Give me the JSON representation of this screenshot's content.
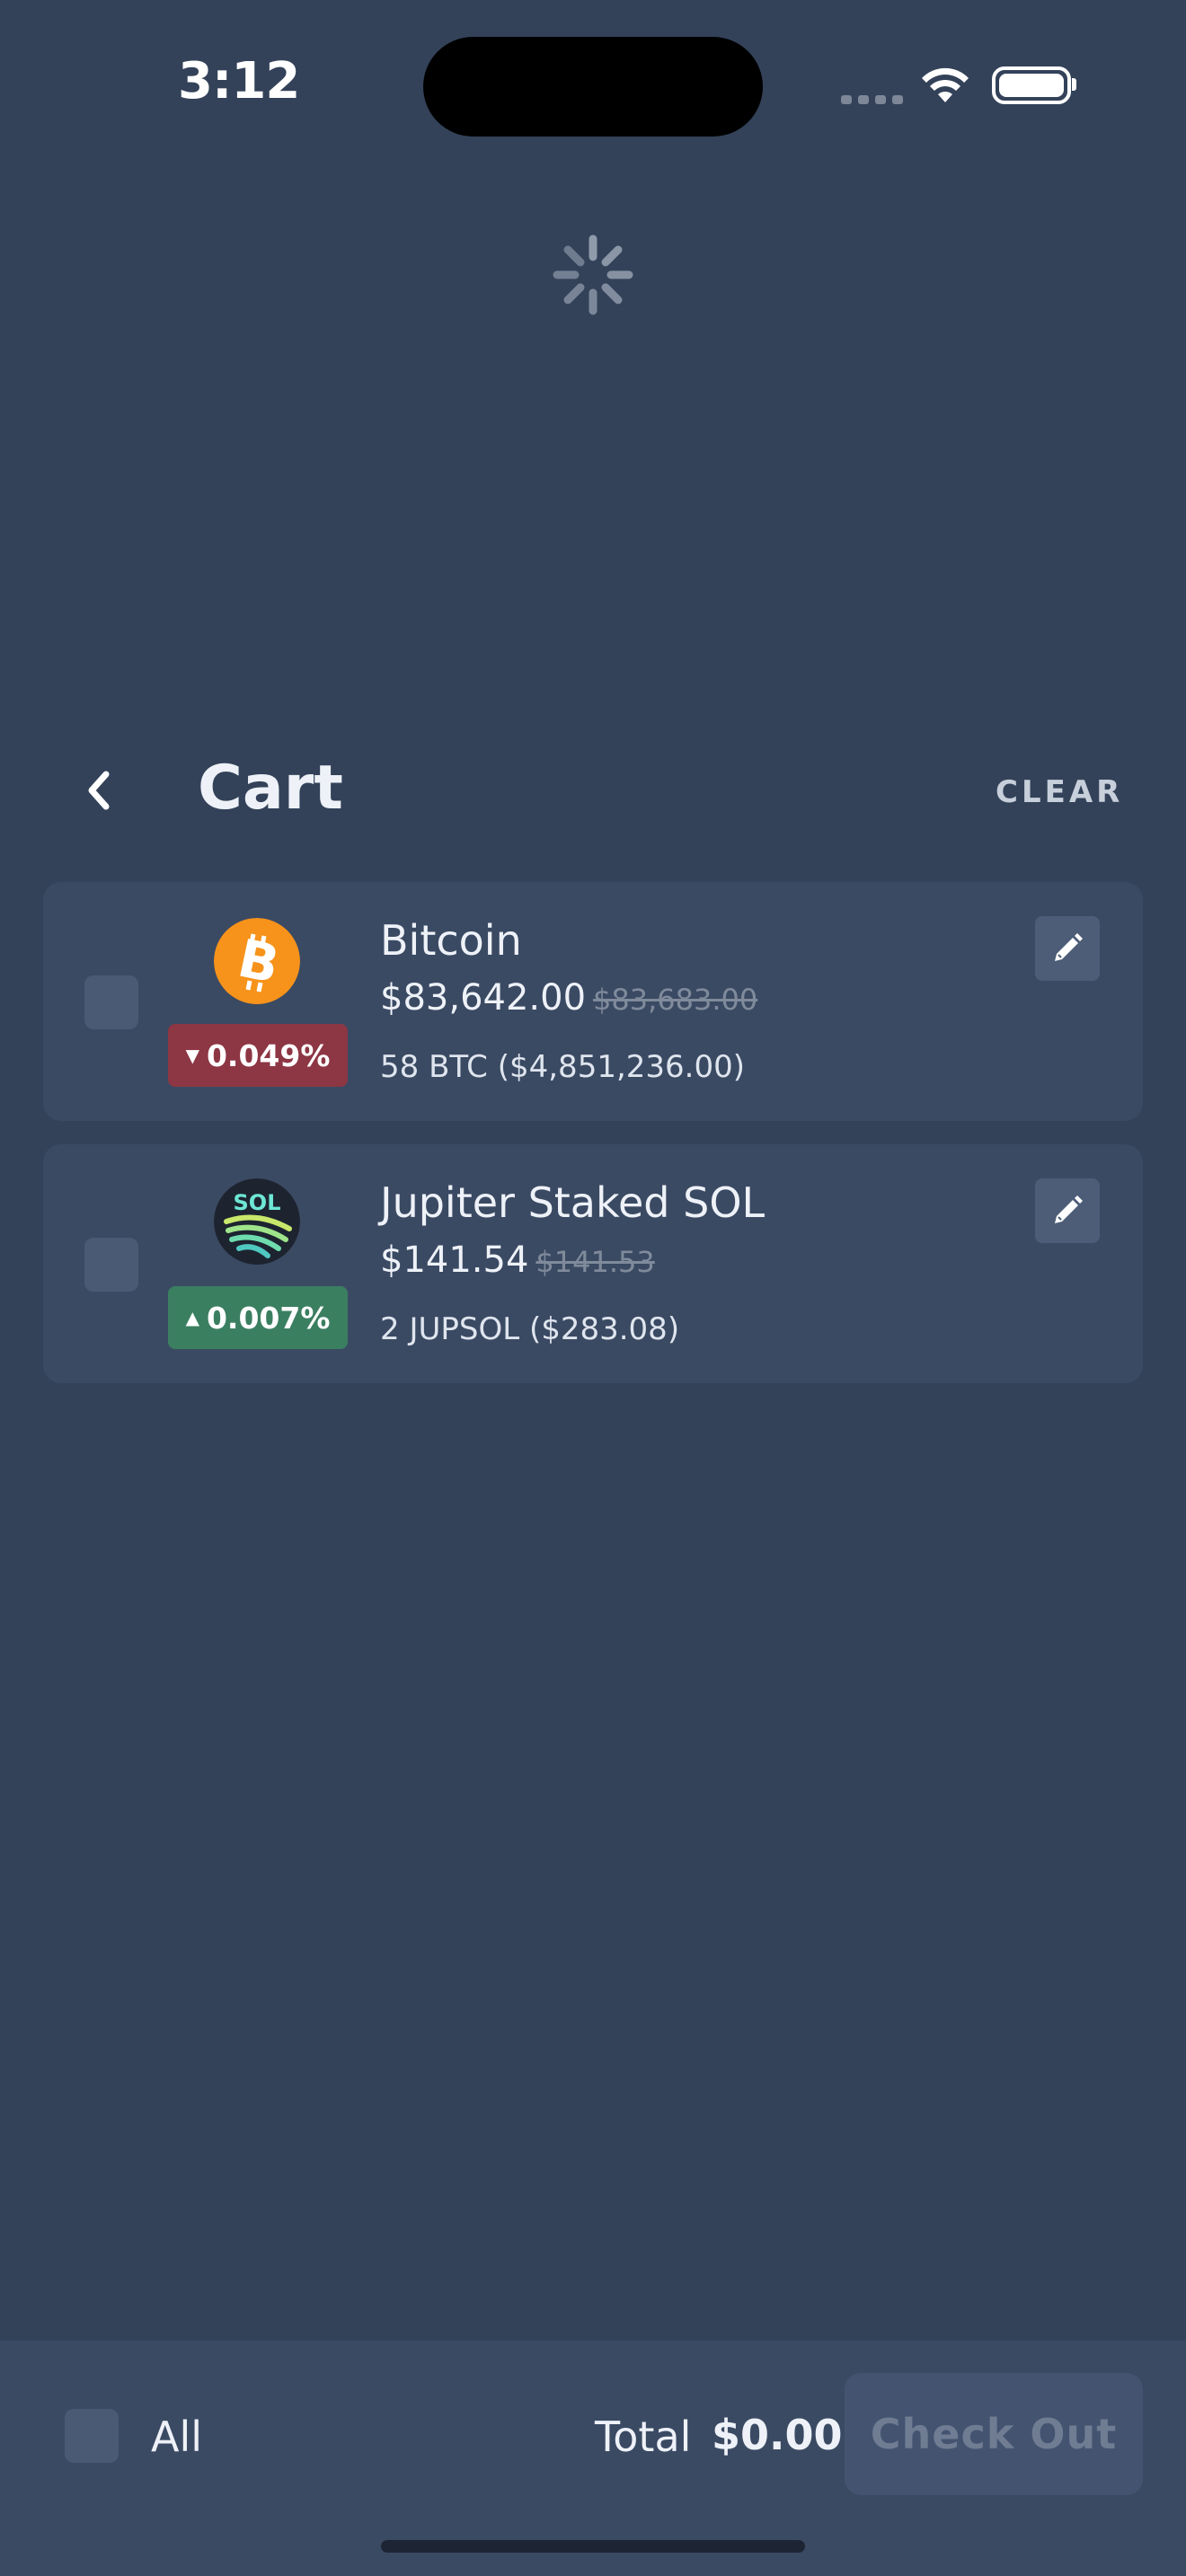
{
  "status_bar": {
    "time": "3:12"
  },
  "header": {
    "title": "Cart",
    "clear_label": "CLEAR"
  },
  "cart_items": [
    {
      "name": "Bitcoin",
      "icon": "bitcoin-icon",
      "icon_color": "#f7931a",
      "change": "0.049%",
      "change_direction": "down",
      "price": "$83,642.00",
      "old_price": "$83,683.00",
      "holding": "58 BTC ($4,851,236.00)",
      "checked": false
    },
    {
      "name": "Jupiter Staked SOL",
      "icon": "jupsol-icon",
      "icon_text": "SOL",
      "change": "0.007%",
      "change_direction": "up",
      "price": "$141.54",
      "old_price": "$141.53",
      "holding": "2 JUPSOL ($283.08)",
      "checked": false
    }
  ],
  "footer": {
    "all_label": "All",
    "total_label": "Total",
    "total_value": "$0.00",
    "checkout_label": "Check Out"
  },
  "colors": {
    "background": "#334259",
    "card": "#3b4a63",
    "badge_down": "#8d3644",
    "badge_up": "#3b7f61"
  }
}
